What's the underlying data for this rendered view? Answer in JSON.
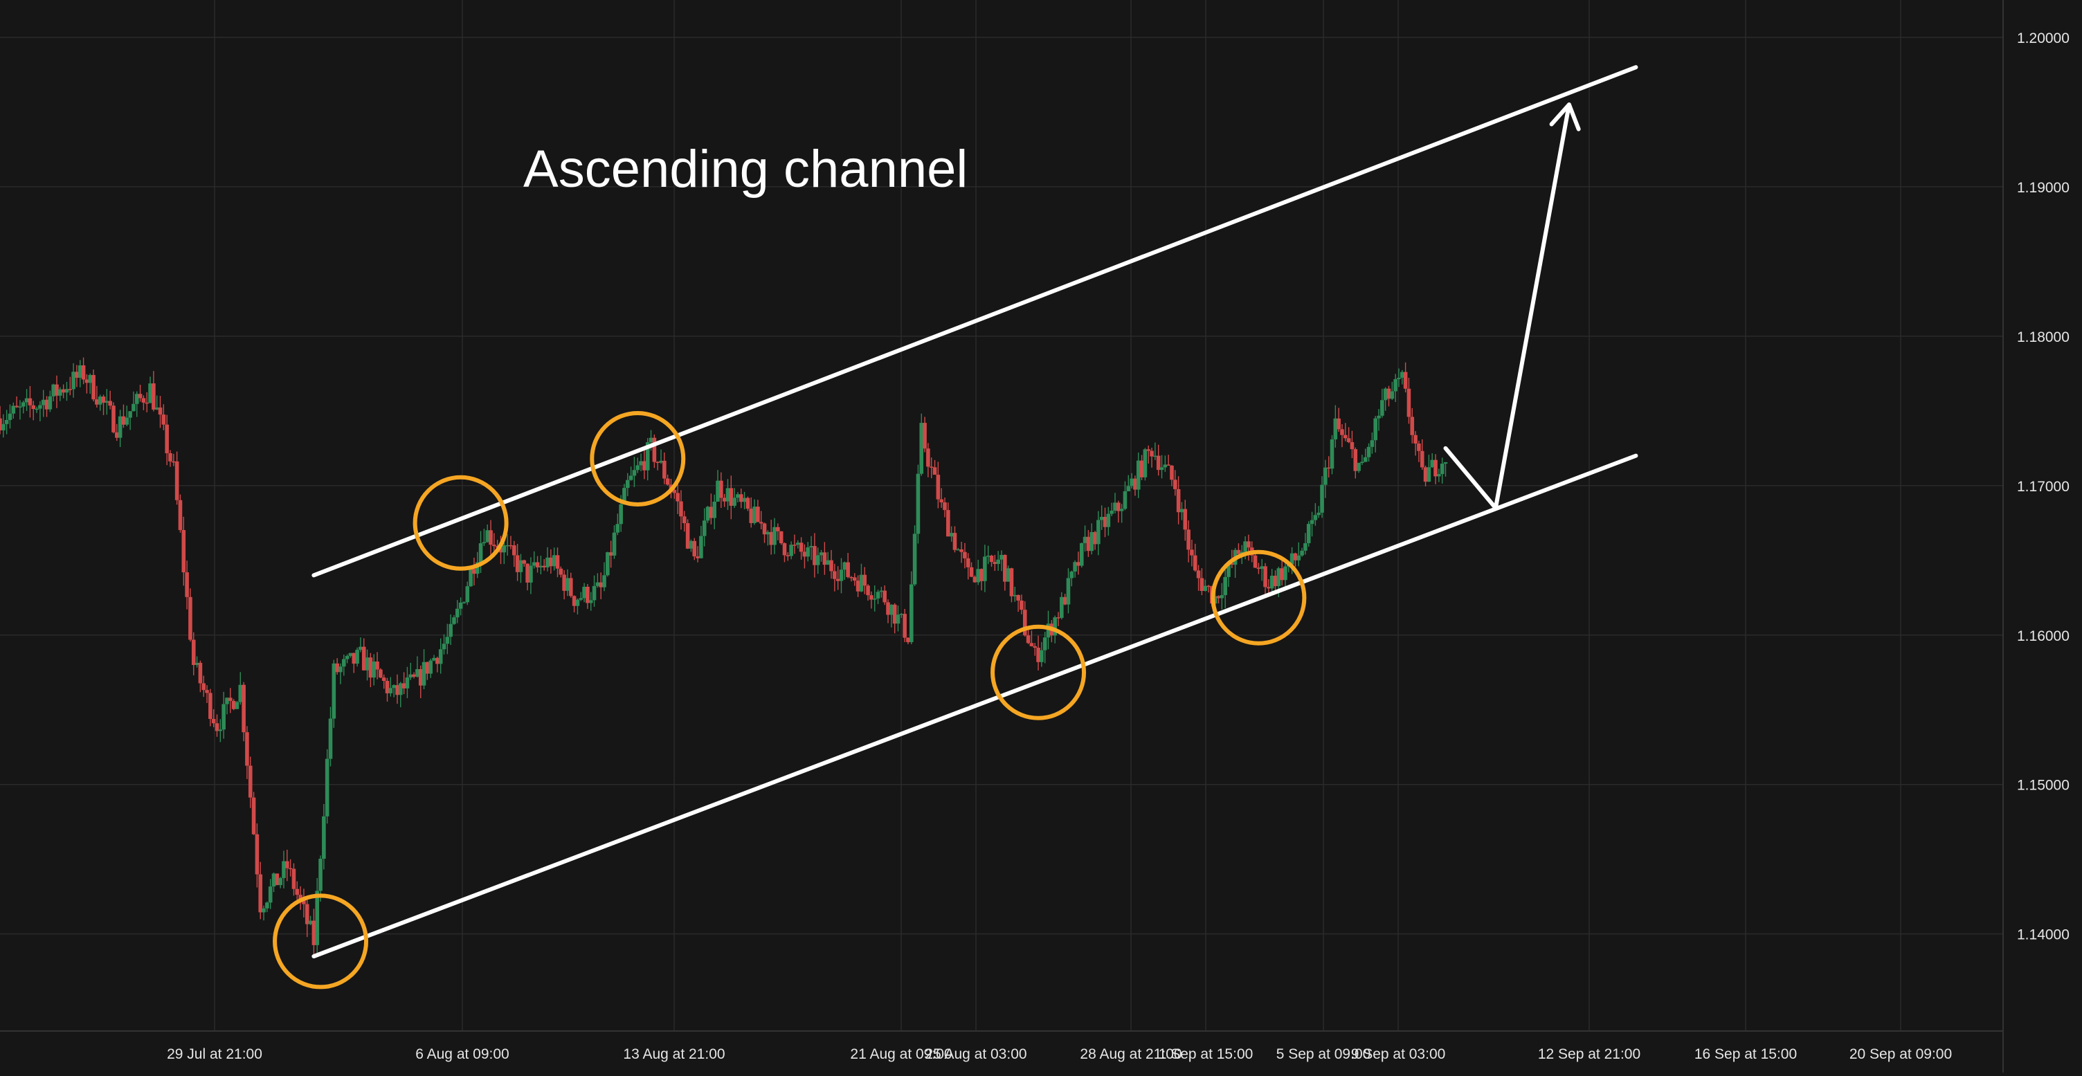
{
  "colors": {
    "background": "#161616",
    "grid": "#2a2a2a",
    "axis_text": "#e6e6e6",
    "candle_up": "#2e8b57",
    "candle_down": "#d14a4a",
    "annotation_line": "#ffffff",
    "circle": "#f5a623"
  },
  "chart_data": {
    "type": "candlestick",
    "title": "Ascending channel",
    "instrument": "",
    "price_axis": {
      "side": "right",
      "ylim": [
        1.1335,
        1.2025
      ],
      "ticks": [
        "1.20000",
        "1.19000",
        "1.18000",
        "1.17000",
        "1.16000",
        "1.15000",
        "1.14000"
      ]
    },
    "time_axis": {
      "ticks": [
        "29 Jul at 21:00",
        "6 Aug at 09:00",
        "13 Aug at 21:00",
        "21 Aug at 09:00",
        "25 Aug at 03:00",
        "28 Aug at 21:00",
        "1 Sep at 15:00",
        "5 Sep at 09:00",
        "9 Sep at 03:00",
        "12 Sep at 21:00",
        "16 Sep at 15:00",
        "20 Sep at 09:00"
      ],
      "range_bars": [
        0,
        600
      ],
      "data_end_bar": 433
    },
    "price_path": [
      [
        0,
        1.1745
      ],
      [
        12,
        1.1755
      ],
      [
        25,
        1.1775
      ],
      [
        35,
        1.174
      ],
      [
        45,
        1.1765
      ],
      [
        52,
        1.171
      ],
      [
        58,
        1.158
      ],
      [
        65,
        1.154
      ],
      [
        72,
        1.1565
      ],
      [
        78,
        1.142
      ],
      [
        86,
        1.1445
      ],
      [
        94,
        1.1395
      ],
      [
        100,
        1.1575
      ],
      [
        108,
        1.1585
      ],
      [
        118,
        1.156
      ],
      [
        125,
        1.157
      ],
      [
        135,
        1.16
      ],
      [
        145,
        1.167
      ],
      [
        152,
        1.1655
      ],
      [
        158,
        1.164
      ],
      [
        165,
        1.165
      ],
      [
        172,
        1.1625
      ],
      [
        180,
        1.163
      ],
      [
        188,
        1.17
      ],
      [
        195,
        1.1725
      ],
      [
        202,
        1.1695
      ],
      [
        208,
        1.165
      ],
      [
        215,
        1.17
      ],
      [
        225,
        1.168
      ],
      [
        235,
        1.166
      ],
      [
        245,
        1.165
      ],
      [
        255,
        1.164
      ],
      [
        265,
        1.1625
      ],
      [
        272,
        1.16
      ],
      [
        276,
        1.1735
      ],
      [
        282,
        1.1685
      ],
      [
        290,
        1.164
      ],
      [
        300,
        1.165
      ],
      [
        310,
        1.1585
      ],
      [
        318,
        1.162
      ],
      [
        325,
        1.166
      ],
      [
        335,
        1.1685
      ],
      [
        345,
        1.1725
      ],
      [
        352,
        1.17
      ],
      [
        358,
        1.164
      ],
      [
        364,
        1.1625
      ],
      [
        372,
        1.166
      ],
      [
        380,
        1.1635
      ],
      [
        388,
        1.165
      ],
      [
        394,
        1.1675
      ],
      [
        400,
        1.174
      ],
      [
        408,
        1.171
      ],
      [
        414,
        1.1755
      ],
      [
        420,
        1.177
      ],
      [
        426,
        1.1705
      ],
      [
        433,
        1.172
      ]
    ],
    "annotations": {
      "channel_upper": [
        [
          94,
          1.164
        ],
        [
          490,
          1.198
        ]
      ],
      "channel_lower": [
        [
          94,
          1.1385
        ],
        [
          490,
          1.172
        ]
      ],
      "touch_points": [
        [
          96,
          1.1395
        ],
        [
          138,
          1.1675
        ],
        [
          191,
          1.1718
        ],
        [
          311,
          1.1575
        ],
        [
          377,
          1.1625
        ]
      ],
      "projection": [
        [
          433,
          1.1725
        ],
        [
          448,
          1.1685
        ],
        [
          470,
          1.1955
        ]
      ]
    }
  }
}
